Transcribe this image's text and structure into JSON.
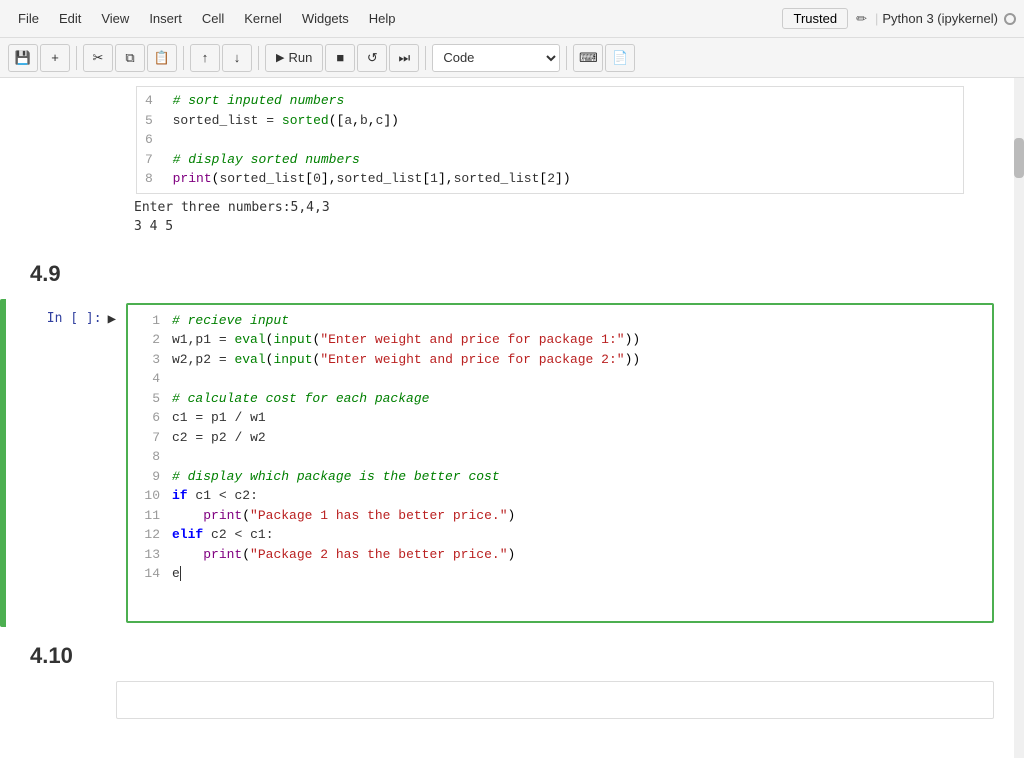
{
  "menubar": {
    "items": [
      "File",
      "Edit",
      "View",
      "Insert",
      "Cell",
      "Kernel",
      "Widgets",
      "Help"
    ],
    "trusted_label": "Trusted",
    "kernel_label": "Python 3 (ipykernel)"
  },
  "toolbar": {
    "save_label": "💾",
    "add_label": "+",
    "cut_label": "✂",
    "copy_label": "⧉",
    "paste_label": "📋",
    "move_up_label": "↑",
    "move_down_label": "↓",
    "run_label": "Run",
    "stop_label": "■",
    "restart_label": "↺",
    "fast_forward_label": "⏭",
    "cell_type": "Code",
    "keyboard_label": "⌨",
    "doc_label": "📄"
  },
  "notebook": {
    "section_49": "4.9",
    "section_410": "4.10",
    "prev_cell": {
      "lines": [
        {
          "num": "4",
          "code": "# sort inputed numbers",
          "type": "comment"
        },
        {
          "num": "5",
          "code": "sorted_list = sorted([a,b,c])",
          "type": "code"
        },
        {
          "num": "6",
          "code": "",
          "type": "empty"
        },
        {
          "num": "7",
          "code": "# display sorted numbers",
          "type": "comment"
        },
        {
          "num": "8",
          "code": "print(sorted_list[0],sorted_list[1],sorted_list[2])",
          "type": "code"
        }
      ],
      "output": [
        "Enter three numbers:5,4,3",
        "3 4 5"
      ]
    },
    "active_cell": {
      "prompt": "In [ ]:",
      "lines": [
        {
          "num": "1",
          "html": "<span class='c-comment'># recieve input</span>"
        },
        {
          "num": "2",
          "html": "<span class='c-var'>w1,p1</span> <span class='c-op'>=</span> <span class='c-builtin'>eval</span>(<span class='c-builtin'>input</span>(<span class='c-string'>\"Enter weight and price for package 1:\"</span>))"
        },
        {
          "num": "3",
          "html": "<span class='c-var'>w2,p2</span> <span class='c-op'>=</span> <span class='c-builtin'>eval</span>(<span class='c-builtin'>input</span>(<span class='c-string'>\"Enter weight and price for package 2:\"</span>))"
        },
        {
          "num": "4",
          "html": ""
        },
        {
          "num": "5",
          "html": "<span class='c-comment'># calculate cost for each package</span>"
        },
        {
          "num": "6",
          "html": "<span class='c-var'>c1</span> <span class='c-op'>=</span> <span class='c-var'>p1</span> <span class='c-op'>/</span> <span class='c-var'>w1</span>"
        },
        {
          "num": "7",
          "html": "<span class='c-var'>c2</span> <span class='c-op'>=</span> <span class='c-var'>p2</span> <span class='c-op'>/</span> <span class='c-var'>w2</span>"
        },
        {
          "num": "8",
          "html": ""
        },
        {
          "num": "9",
          "html": "<span class='c-comment'># display which package is the better cost</span>"
        },
        {
          "num": "10",
          "html": "<span class='c-keyword'>if</span> <span class='c-var'>c1</span> <span class='c-op'>&lt;</span> <span class='c-var'>c2</span><span class='c-op'>:</span>"
        },
        {
          "num": "11",
          "html": "    <span class='c-func'>print</span>(<span class='c-string'>\"Package 1 has the better price.\"</span>)"
        },
        {
          "num": "12",
          "html": "<span class='c-keyword'>elif</span> <span class='c-var'>c2</span> <span class='c-op'>&lt;</span> <span class='c-var'>c1</span><span class='c-op'>:</span>"
        },
        {
          "num": "13",
          "html": "    <span class='c-func'>print</span>(<span class='c-string'>\"Package 2 has the better price.\"</span>)"
        },
        {
          "num": "14",
          "html": "<span class='c-var'>e</span><span style='border-left:2px solid #333;'></span>"
        }
      ]
    }
  }
}
